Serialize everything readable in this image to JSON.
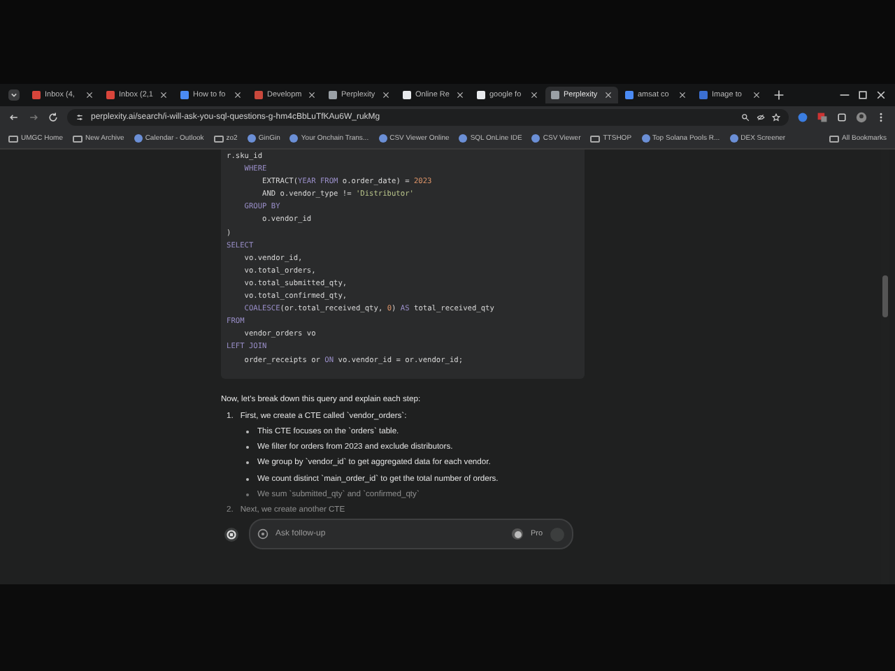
{
  "tabs": [
    {
      "label": "Inbox (4,",
      "color": "#d9453b",
      "selected": false
    },
    {
      "label": "Inbox (2,1",
      "color": "#d9453b",
      "selected": false
    },
    {
      "label": "How to fo",
      "color": "#4a8af4",
      "selected": false
    },
    {
      "label": "Developm",
      "color": "#c9483c",
      "selected": false
    },
    {
      "label": "Perplexity",
      "color": "#9aa0a6",
      "selected": false
    },
    {
      "label": "Online Re",
      "color": "#e8eaed",
      "selected": false
    },
    {
      "label": "google fo",
      "color": "#e8eaed",
      "selected": false
    },
    {
      "label": "Perplexity",
      "color": "#9aa0a6",
      "selected": true
    },
    {
      "label": "amsat co",
      "color": "#4a8af4",
      "selected": false
    },
    {
      "label": "Image to",
      "color": "#3b6fd1",
      "selected": false
    }
  ],
  "address_bar": {
    "url": "perplexity.ai/search/i-will-ask-you-sql-questions-g-hm4cBbLuTfKAu6W_rukMg"
  },
  "bookmarks": [
    {
      "label": "UMGC Home",
      "kind": "folder"
    },
    {
      "label": "New Archive",
      "kind": "folder"
    },
    {
      "label": "Calendar - Outlook",
      "kind": "site"
    },
    {
      "label": "zo2",
      "kind": "folder"
    },
    {
      "label": "GinGin",
      "kind": "site"
    },
    {
      "label": "Your Onchain Trans...",
      "kind": "site"
    },
    {
      "label": "CSV Viewer Online",
      "kind": "site"
    },
    {
      "label": "SQL OnLine IDE",
      "kind": "site"
    },
    {
      "label": "CSV Viewer",
      "kind": "site"
    },
    {
      "label": "TTSHOP",
      "kind": "folder"
    },
    {
      "label": "Top Solana Pools R...",
      "kind": "site"
    },
    {
      "label": "DEX Screener",
      "kind": "site"
    },
    {
      "label": "All Bookmarks",
      "kind": "folder"
    }
  ],
  "code_lines": [
    [
      {
        "t": "r.sku_id",
        "kind": "plain"
      }
    ],
    [
      {
        "t": "    WHERE",
        "kind": "kw"
      }
    ],
    [
      {
        "t": "        EXTRACT(",
        "kind": "plain"
      },
      {
        "t": "YEAR FROM",
        "kind": "kw"
      },
      {
        "t": " o.order_date) = ",
        "kind": "plain"
      },
      {
        "t": "2023",
        "kind": "num"
      }
    ],
    [
      {
        "t": "        AND o.vendor_type != ",
        "kind": "plain"
      },
      {
        "t": "'Distributor'",
        "kind": "str"
      }
    ],
    [
      {
        "t": "    GROUP BY",
        "kind": "kw"
      }
    ],
    [
      {
        "t": "        o.vendor_id",
        "kind": "plain"
      }
    ],
    [
      {
        "t": ")",
        "kind": "plain"
      }
    ],
    [
      {
        "t": "SELECT",
        "kind": "kw"
      }
    ],
    [
      {
        "t": "    vo.vendor_id,",
        "kind": "plain"
      }
    ],
    [
      {
        "t": "    vo.total_orders,",
        "kind": "plain"
      }
    ],
    [
      {
        "t": "    vo.total_submitted_qty,",
        "kind": "plain"
      }
    ],
    [
      {
        "t": "    vo.total_confirmed_qty,",
        "kind": "plain"
      }
    ],
    [
      {
        "t": "    COALESCE",
        "kind": "kw"
      },
      {
        "t": "(or.total_received_qty, ",
        "kind": "plain"
      },
      {
        "t": "0",
        "kind": "num"
      },
      {
        "t": ") ",
        "kind": "plain"
      },
      {
        "t": "AS",
        "kind": "kw"
      },
      {
        "t": " total_received_qty",
        "kind": "plain"
      }
    ],
    [
      {
        "t": "FROM",
        "kind": "kw"
      }
    ],
    [
      {
        "t": "    vendor_orders vo",
        "kind": "plain"
      }
    ],
    [
      {
        "t": "LEFT JOIN",
        "kind": "kw"
      }
    ],
    [
      {
        "t": "    order_receipts or ",
        "kind": "plain"
      },
      {
        "t": "ON",
        "kind": "kw"
      },
      {
        "t": " vo.vendor_id = or.vendor_id;",
        "kind": "plain"
      }
    ]
  ],
  "intro": "Now, let's break down this query and explain each step:",
  "steps": [
    {
      "number": "1.",
      "text": "First, we create a CTE called `vendor_orders`:",
      "faded": false,
      "children": [
        {
          "text": "This CTE focuses on the `orders` table.",
          "faded": false
        },
        {
          "text": "We filter for orders from 2023 and exclude distributors.",
          "faded": false
        },
        {
          "text": "We group by `vendor_id` to get aggregated data for each vendor.",
          "faded": false
        },
        {
          "text": "We count distinct `main_order_id` to get the total number of orders.",
          "faded": false
        },
        {
          "text": "We sum `submitted_qty` and `confirmed_qty`",
          "faded": true
        }
      ]
    },
    {
      "number": "2.",
      "text": "Next, we create another CTE",
      "faded": true
    }
  ],
  "followup": {
    "placeholder": "Ask follow-up",
    "pro_label": "Pro",
    "pro_on": false
  }
}
